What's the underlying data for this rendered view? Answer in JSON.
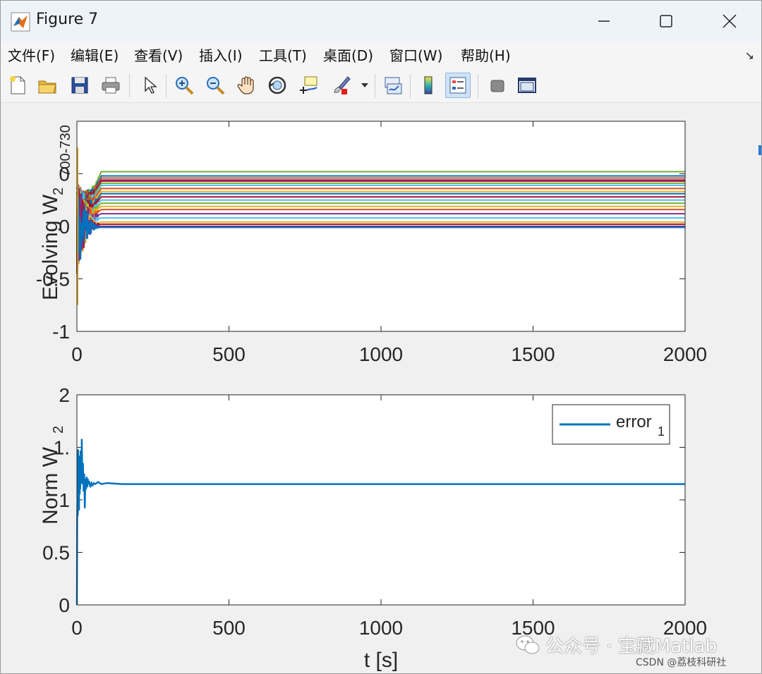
{
  "window": {
    "title": "Figure 7",
    "icon": "matlab-logo-icon",
    "controls": [
      "minimize-icon",
      "maximize-icon",
      "close-icon"
    ]
  },
  "menu": {
    "items": [
      "文件(F)",
      "编辑(E)",
      "查看(V)",
      "插入(I)",
      "工具(T)",
      "桌面(D)",
      "窗口(W)",
      "帮助(H)"
    ],
    "overflow_arrow": "↘"
  },
  "toolbar": {
    "buttons": [
      "new-figure-icon",
      "open-file-icon",
      "save-icon",
      "print-icon",
      "select-pointer-icon",
      "zoom-in-icon",
      "zoom-out-icon",
      "pan-hand-icon",
      "rotate-3d-icon",
      "data-cursor-icon",
      "brush-icon",
      "link-plot-icon",
      "colorbar-icon",
      "legend-icon",
      "hide-plot-tools-icon",
      "show-plot-tools-icon"
    ],
    "active": "legend-icon"
  },
  "chart_data": [
    {
      "type": "line",
      "ylabel": "Evolving W",
      "ylabel_sub": "2",
      "ytick_top_label": "700-730",
      "xlim": [
        0,
        2000
      ],
      "ylim": [
        -1,
        1
      ],
      "xticks": [
        0,
        500,
        1000,
        1500,
        2000
      ],
      "yticks": [
        -1,
        -0.5,
        0,
        0.5
      ],
      "ytick_labels": [
        "-1",
        "-0.5",
        "0",
        "0"
      ],
      "grid": false,
      "series_final_values": [
        0.52,
        0.48,
        0.46,
        0.44,
        0.43,
        0.41,
        0.39,
        0.36,
        0.33,
        0.31,
        0.28,
        0.25,
        0.22,
        0.19,
        0.16,
        0.12,
        0.08,
        0.04,
        0.02,
        0.0,
        -0.01
      ],
      "series_colors": [
        "#77ac30",
        "#0072bd",
        "#d95319",
        "#7e2f8e",
        "#a2142f",
        "#77ac30",
        "#4dbeee",
        "#d95319",
        "#edb120",
        "#0072bd",
        "#a2142f",
        "#4dbeee",
        "#77ac30",
        "#edb120",
        "#d95319",
        "#7e2f8e",
        "#4dbeee",
        "#edb120",
        "#a2142f",
        "#7e2f8e",
        "#0072bd"
      ],
      "transient_end": 80
    },
    {
      "type": "line",
      "ylabel": "Norm W",
      "ylabel_sub": "2",
      "xlabel": "t [s]",
      "xlim": [
        0,
        2000
      ],
      "ylim": [
        0,
        2
      ],
      "xticks": [
        0,
        500,
        1000,
        1500,
        2000
      ],
      "yticks": [
        0,
        0.5,
        1,
        1.5,
        2
      ],
      "ytick_labels": [
        "0",
        "0.5",
        "1",
        "1.",
        "2"
      ],
      "grid": false,
      "legend": {
        "entry": "error",
        "entry_sub": "1",
        "position": "top-right"
      },
      "series": [
        {
          "name": "error1",
          "color": "#0072bd",
          "x": [
            0,
            1,
            2,
            3,
            4,
            5,
            6,
            7,
            8,
            9,
            10,
            11,
            12,
            13,
            14,
            15,
            16,
            18,
            20,
            22,
            24,
            26,
            28,
            30,
            32,
            34,
            36,
            38,
            40,
            44,
            48,
            52,
            56,
            60,
            70,
            80,
            100,
            150,
            200,
            2000
          ],
          "y": [
            0,
            0.82,
            1.05,
            0.85,
            1.48,
            1.0,
            1.42,
            0.9,
            1.35,
            1.05,
            1.3,
            1.1,
            1.47,
            1.15,
            1.35,
            1.2,
            1.58,
            1.15,
            1.35,
            1.08,
            1.25,
            0.92,
            1.2,
            1.1,
            1.22,
            1.12,
            1.2,
            1.15,
            1.18,
            1.12,
            1.16,
            1.14,
            1.16,
            1.15,
            1.17,
            1.15,
            1.16,
            1.15,
            1.15,
            1.15
          ]
        }
      ]
    }
  ],
  "watermark": {
    "main": "公众号 · 宝藏Matlab",
    "sub": "CSDN @荔枝科研社"
  }
}
